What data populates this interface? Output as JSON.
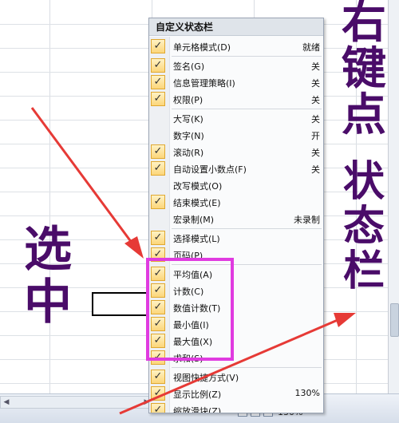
{
  "menu": {
    "title": "自定义状态栏",
    "items": [
      {
        "label": "单元格模式(D)",
        "value": "就绪",
        "checked": true
      },
      {
        "label": "签名(G)",
        "value": "关",
        "checked": true
      },
      {
        "label": "信息管理策略(I)",
        "value": "关",
        "checked": true
      },
      {
        "label": "权限(P)",
        "value": "关",
        "checked": true
      },
      {
        "label": "大写(K)",
        "value": "关",
        "checked": false
      },
      {
        "label": "数字(N)",
        "value": "开",
        "checked": false
      },
      {
        "label": "滚动(R)",
        "value": "关",
        "checked": true
      },
      {
        "label": "自动设置小数点(F)",
        "value": "关",
        "checked": true
      },
      {
        "label": "改写模式(O)",
        "value": "",
        "checked": false
      },
      {
        "label": "结束模式(E)",
        "value": "",
        "checked": true
      },
      {
        "label": "宏录制(M)",
        "value": "未录制",
        "checked": false
      },
      {
        "label": "选择模式(L)",
        "value": "",
        "checked": true
      },
      {
        "label": "页码(P)",
        "value": "",
        "checked": true
      },
      {
        "label": "平均值(A)",
        "value": "",
        "checked": true
      },
      {
        "label": "计数(C)",
        "value": "",
        "checked": true
      },
      {
        "label": "数值计数(T)",
        "value": "",
        "checked": true
      },
      {
        "label": "最小值(I)",
        "value": "",
        "checked": true
      },
      {
        "label": "最大值(X)",
        "value": "",
        "checked": true
      },
      {
        "label": "求和(S)",
        "value": "",
        "checked": true
      },
      {
        "label": "视图快捷方式(V)",
        "value": "",
        "checked": true
      },
      {
        "label": "显示比例(Z)",
        "value": "130%",
        "checked": true
      },
      {
        "label": "缩放滑块(Z)",
        "value": "",
        "checked": true
      }
    ]
  },
  "statusbar": {
    "zoom": "130%"
  },
  "annotations": {
    "right_top": "右键点",
    "right_bottom": "状态栏",
    "left": "选中"
  },
  "colors": {
    "highlight": "#e03be0",
    "annotation": "#4a0c69",
    "arrow": "#e63a36",
    "check_bg": "#fcd67a"
  }
}
